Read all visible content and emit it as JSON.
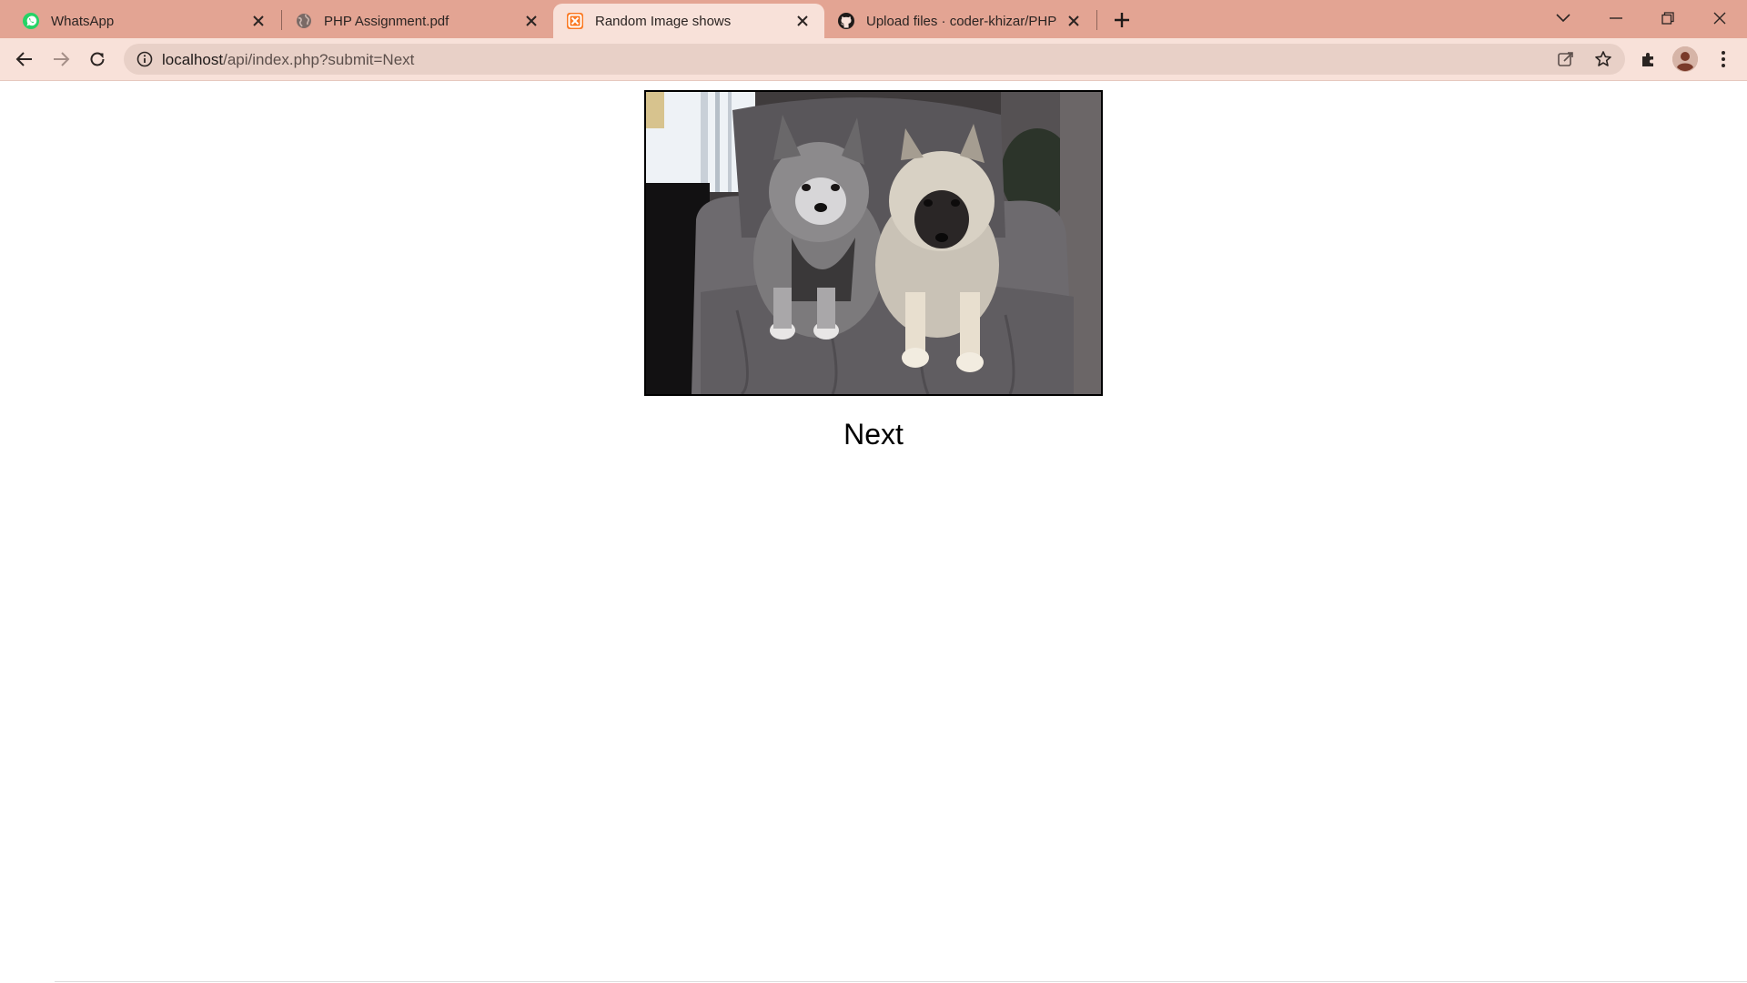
{
  "tabs": [
    {
      "title": "WhatsApp",
      "icon": "whatsapp-icon",
      "active": false
    },
    {
      "title": "PHP Assignment.pdf",
      "icon": "globe-icon",
      "active": false
    },
    {
      "title": "Random Image shows",
      "icon": "xampp-icon",
      "active": true
    },
    {
      "title": "Upload files · coder-khizar/PHP-F",
      "icon": "github-icon",
      "active": false
    }
  ],
  "toolbar": {
    "url_host": "localhost",
    "url_path": "/api/index.php?submit=Next"
  },
  "page": {
    "image_alt": "Two Keeshond dogs on a grey armchair",
    "next_label": "Next"
  },
  "colors": {
    "tabstrip": "#e3a493",
    "toolbar": "#f8e1d9",
    "omnibox": "#e8d0c7"
  }
}
